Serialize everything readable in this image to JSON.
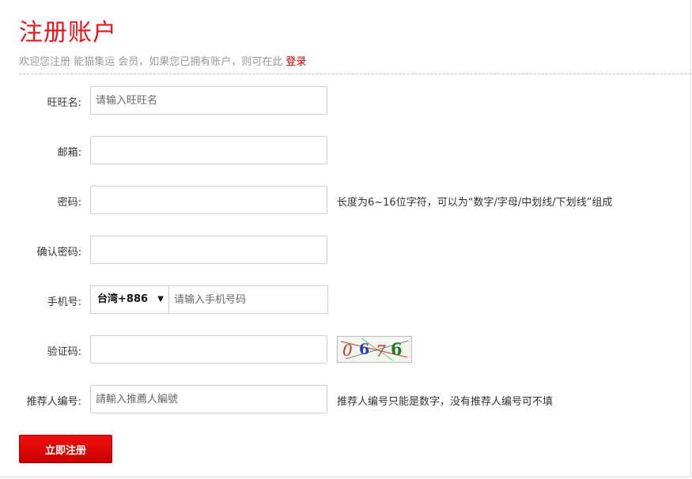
{
  "header": {
    "title": "注册账户",
    "subtitle_prefix": "欢迎您注册 能猫集运 会员，如果您已拥有账户，则可在此",
    "login_link": "登录"
  },
  "form": {
    "wangwang": {
      "label": "旺旺名:",
      "placeholder": "请输入旺旺名"
    },
    "email": {
      "label": "邮箱:"
    },
    "password": {
      "label": "密码:",
      "hint": "长度为6~16位字符，可以为“数字/字母/中划线/下划线”组成"
    },
    "confirm_password": {
      "label": "确认密码:"
    },
    "phone": {
      "label": "手机号:",
      "country": "台湾+886",
      "placeholder": "请输入手机号码"
    },
    "captcha": {
      "label": "验证码:",
      "code": "0676"
    },
    "referrer": {
      "label": "推荐人编号:",
      "placeholder": "請輸入推薦人編號",
      "hint": "推荐人编号只能是数字，没有推荐人编号可不填"
    },
    "submit_label": "立即注册"
  }
}
